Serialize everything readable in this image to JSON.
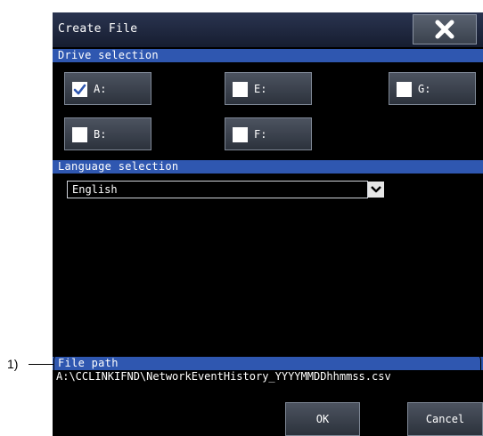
{
  "dialog": {
    "title": "Create File",
    "close_icon": "close-x-icon"
  },
  "drive_section": {
    "header": "Drive selection",
    "drives": [
      {
        "label": "A:",
        "checked": true
      },
      {
        "label": "E:",
        "checked": false
      },
      {
        "label": "G:",
        "checked": false
      },
      {
        "label": "B:",
        "checked": false
      },
      {
        "label": "F:",
        "checked": false
      }
    ]
  },
  "language_section": {
    "header": "Language selection",
    "selected": "English",
    "caret_icon": "chevron-down-icon"
  },
  "file_path_section": {
    "header": "File path",
    "value": "A:\\CCLINKIFND\\NetworkEventHistory_YYYYMMDDhhmmss.csv"
  },
  "buttons": {
    "ok": "OK",
    "cancel": "Cancel"
  },
  "callout": {
    "label": "1)"
  },
  "colors": {
    "section_header": "#2f57b0",
    "background": "#000000",
    "check": "#2f57b0"
  }
}
